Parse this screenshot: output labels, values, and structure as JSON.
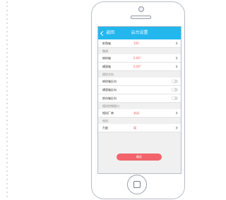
{
  "nav": {
    "back": "返回",
    "title": "云台设置"
  },
  "top_row": {
    "label": "射角轴",
    "value": "100"
  },
  "sections": [
    {
      "title": "微调",
      "rows": [
        {
          "label": "俯仰轴",
          "value": "0.00°",
          "control": "chevron"
        },
        {
          "label": "横滚轴",
          "value": "0.00°",
          "control": "chevron"
        }
      ]
    },
    {
      "title": "遥控方向",
      "rows": [
        {
          "label": "俯仰轴反向",
          "value": "",
          "control": "toggle"
        },
        {
          "label": "横滚轴反向",
          "value": "",
          "control": "toggle"
        },
        {
          "label": "航向轴反向",
          "value": "",
          "control": "toggle"
        }
      ]
    },
    {
      "title": "相机控制接口",
      "rows": [
        {
          "label": "相机厂商",
          "value": "关闭",
          "control": "chevron"
        }
      ]
    },
    {
      "title": "电机",
      "rows": [
        {
          "label": "力度",
          "value": "弱",
          "control": "chevron"
        }
      ]
    }
  ],
  "confirm_button": "确定",
  "colors": {
    "nav": "#23b7ee",
    "accent": "#f05a5a",
    "button": "#f2646a"
  }
}
